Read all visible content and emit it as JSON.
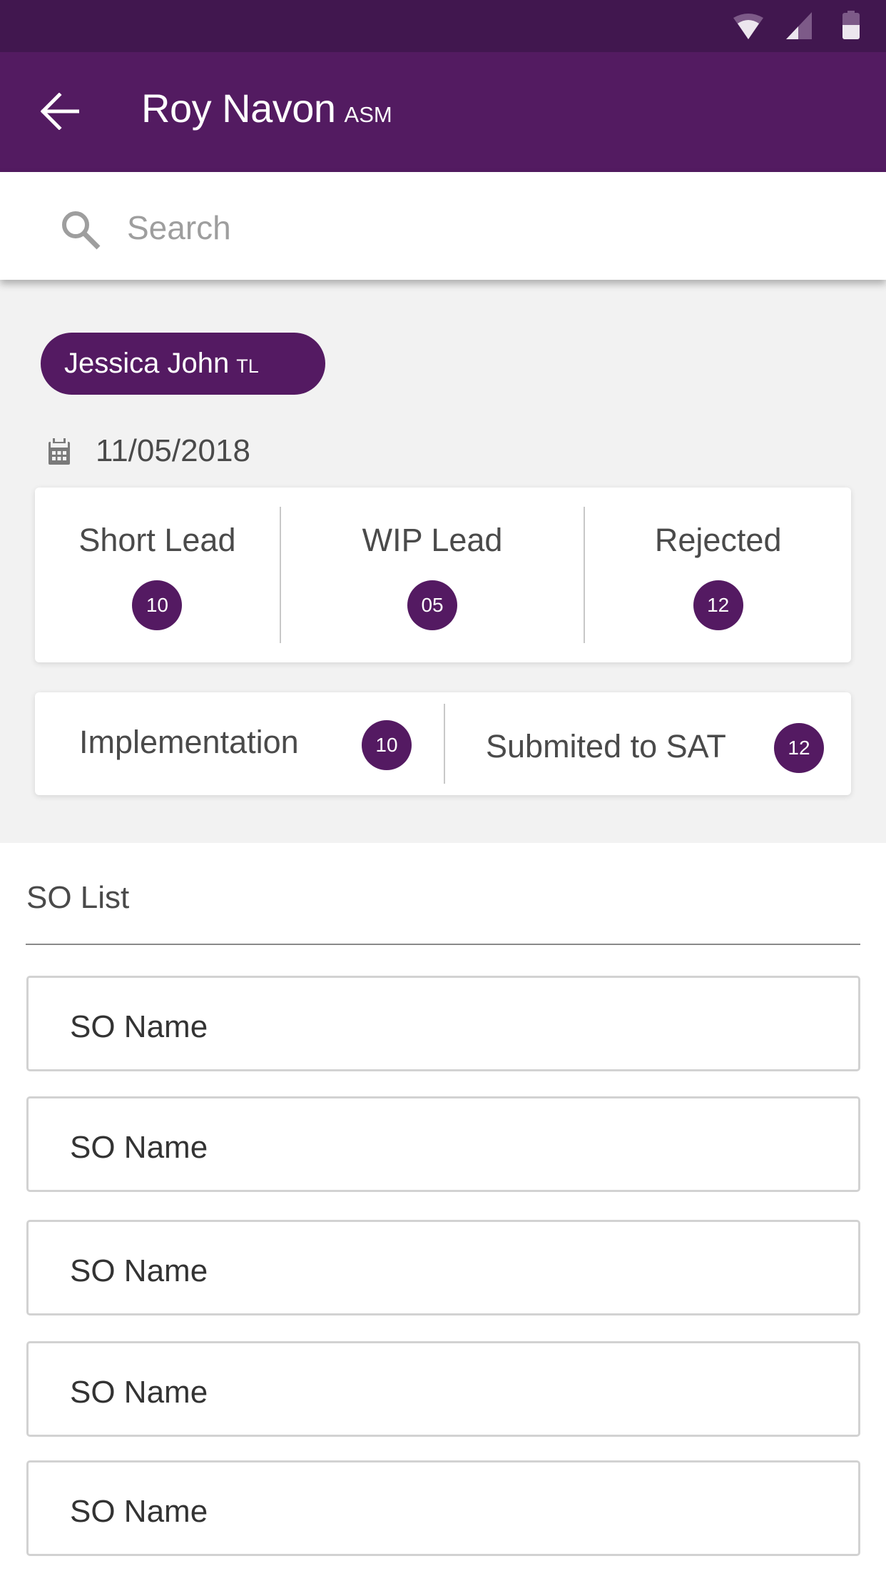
{
  "status_bar": {
    "icons": [
      "wifi-icon",
      "cellular-signal-icon",
      "battery-icon"
    ]
  },
  "app_bar": {
    "back_icon": "arrow-back-icon",
    "title_name": "Roy Navon",
    "title_role": "ASM"
  },
  "search": {
    "icon": "search-icon",
    "placeholder": "Search",
    "value": ""
  },
  "team_member": {
    "name": "Jessica John",
    "role": "TL"
  },
  "date": {
    "icon": "calendar-icon",
    "value": "11/05/2018"
  },
  "stats": [
    {
      "label": "Short Lead",
      "count": "10"
    },
    {
      "label": "WIP Lead",
      "count": "05"
    },
    {
      "label": "Rejected",
      "count": "12"
    }
  ],
  "stages": [
    {
      "label": "Implementation",
      "count": "10"
    },
    {
      "label": "Submited to SAT",
      "count": "12"
    }
  ],
  "so_list": {
    "title": "SO List",
    "items": [
      {
        "label": "SO Name"
      },
      {
        "label": "SO Name"
      },
      {
        "label": "SO Name"
      },
      {
        "label": "SO Name"
      },
      {
        "label": "SO Name"
      }
    ]
  },
  "colors": {
    "status_bar": "#41174f",
    "primary": "#531b61",
    "badge": "#541a62",
    "panel_bg": "#f2f2f2"
  }
}
